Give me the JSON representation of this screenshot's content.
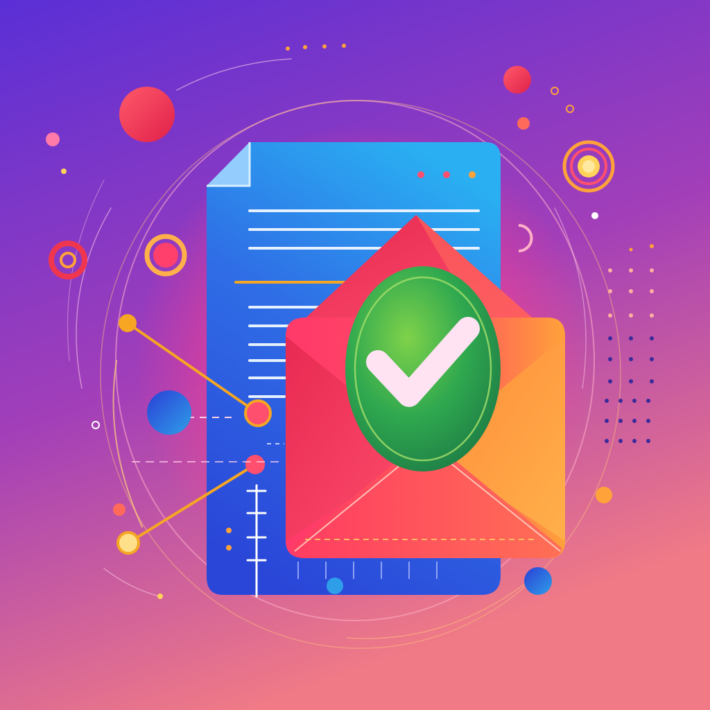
{
  "scene": {
    "subject": "document-and-envelope-with-checkmark",
    "icons": [
      "document-icon",
      "envelope-icon",
      "checkmark-icon",
      "target-ring-icon",
      "connector-node-icon"
    ],
    "colors": {
      "bg_top": "#5a2fd6",
      "bg_mid": "#a33fb8",
      "bg_bottom": "#f07a86",
      "glow": "#ff3f8a",
      "document_top": "#2ab0f2",
      "document_bottom": "#2a46d8",
      "envelope_pink": "#ff3f6c",
      "envelope_orange": "#ffa23a",
      "check_green": "#2fa84f",
      "check_mark": "#ffe3f2",
      "accent_orange": "#f6a623",
      "ring_red": "#f0364f",
      "ring_yellow": "#ffd25a"
    }
  }
}
